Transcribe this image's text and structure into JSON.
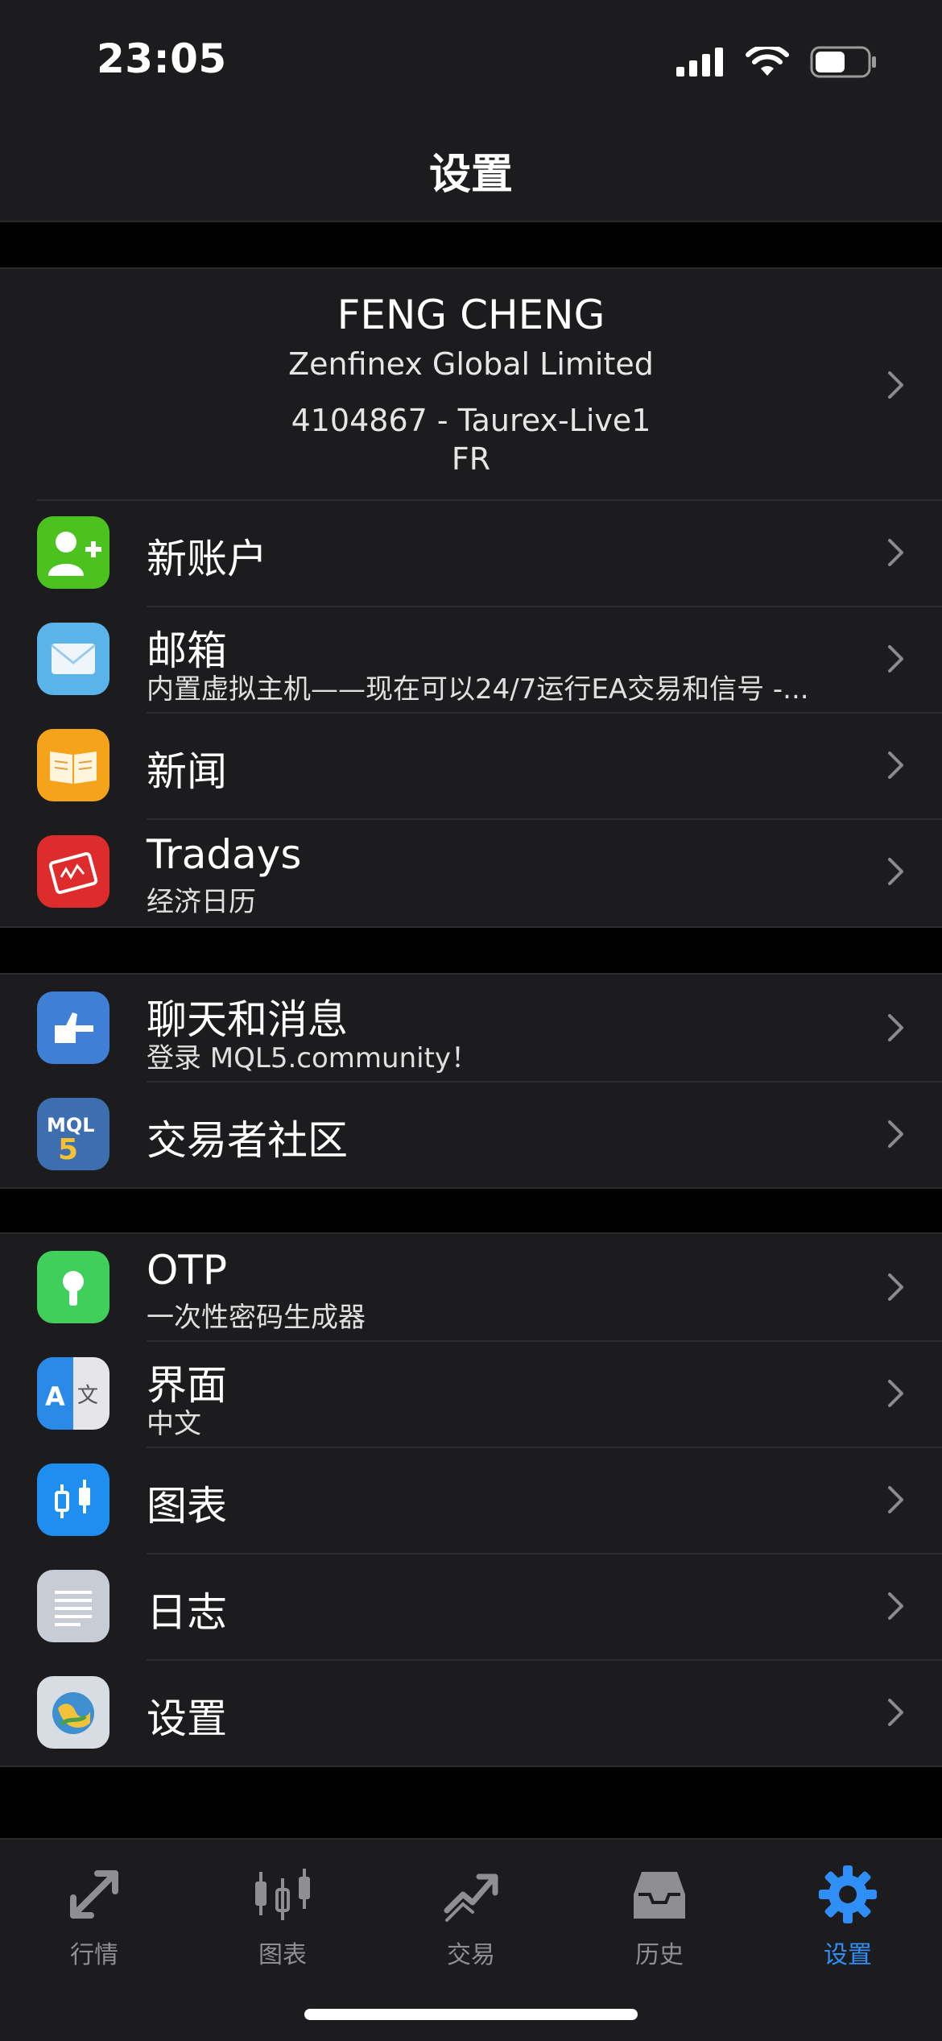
{
  "status": {
    "time": "23:05"
  },
  "nav": {
    "title": "设置"
  },
  "account": {
    "name": "FENG CHENG",
    "company": "Zenfinex Global Limited",
    "number": "4104867 - Taurex-Live1",
    "server": "FR"
  },
  "menu": {
    "new_account": {
      "label": "新账户"
    },
    "mailbox": {
      "label": "邮箱",
      "subtitle": "内置虚拟主机——现在可以24/7运行EA交易和信号 -..."
    },
    "news": {
      "label": "新闻"
    },
    "tradays": {
      "label": "Tradays",
      "subtitle": "经济日历"
    },
    "chat": {
      "label": "聊天和消息",
      "subtitle": "登录 MQL5.community！"
    },
    "community": {
      "label": "交易者社区"
    },
    "otp": {
      "label": "OTP",
      "subtitle": "一次性密码生成器"
    },
    "interface": {
      "label": "界面",
      "subtitle": "中文"
    },
    "charts": {
      "label": "图表"
    },
    "journal": {
      "label": "日志"
    },
    "settings": {
      "label": "设置"
    }
  },
  "tabs": [
    {
      "label": "行情",
      "icon": "quotes-icon"
    },
    {
      "label": "图表",
      "icon": "chart-icon"
    },
    {
      "label": "交易",
      "icon": "trade-icon"
    },
    {
      "label": "历史",
      "icon": "history-icon"
    },
    {
      "label": "设置",
      "icon": "settings-gear-icon",
      "active": true
    }
  ],
  "colors": {
    "accent": "#2f8ff7",
    "background": "#000000",
    "cell": "#1c1c1e"
  }
}
